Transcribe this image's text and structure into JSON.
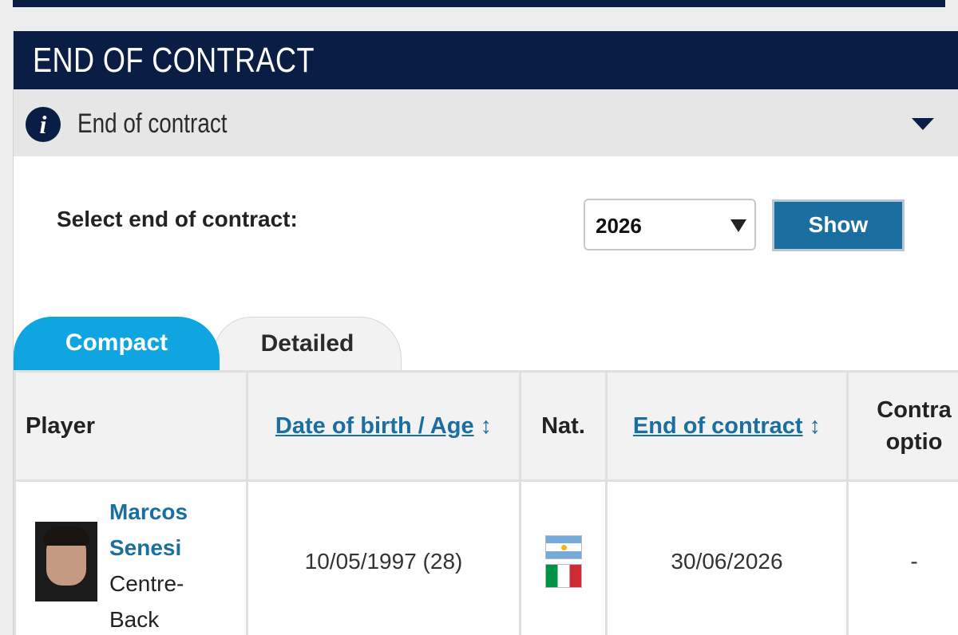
{
  "section": {
    "title": "END OF CONTRACT",
    "info_label": "End of contract"
  },
  "filter": {
    "label": "Select end of contract:",
    "selected_year": "2026",
    "show_button": "Show"
  },
  "tabs": [
    {
      "label": "Compact",
      "active": true
    },
    {
      "label": "Detailed",
      "active": false
    }
  ],
  "table": {
    "columns": {
      "player": "Player",
      "dob_age": "Date of birth / Age",
      "nat": "Nat.",
      "end_of_contract": "End of contract",
      "contract_option_line1": "Contra",
      "contract_option_line2": "optio"
    },
    "rows": [
      {
        "first_name": "Marcos",
        "last_name": "Senesi",
        "position_line1": "Centre-",
        "position_line2": "Back",
        "dob_age": "10/05/1997 (28)",
        "nationalities": [
          "Argentina",
          "Italy"
        ],
        "end_of_contract": "30/06/2026",
        "contract_option": "-"
      }
    ]
  },
  "colors": {
    "header_bg": "#0a1e45",
    "link": "#1a6fa0",
    "tab_active": "#0ea5e1"
  },
  "icons": {
    "info": "info-icon",
    "collapse": "caret-down-icon",
    "sort": "sort-arrows-icon"
  },
  "glyphs": {
    "info": "i",
    "sort": "↕"
  }
}
